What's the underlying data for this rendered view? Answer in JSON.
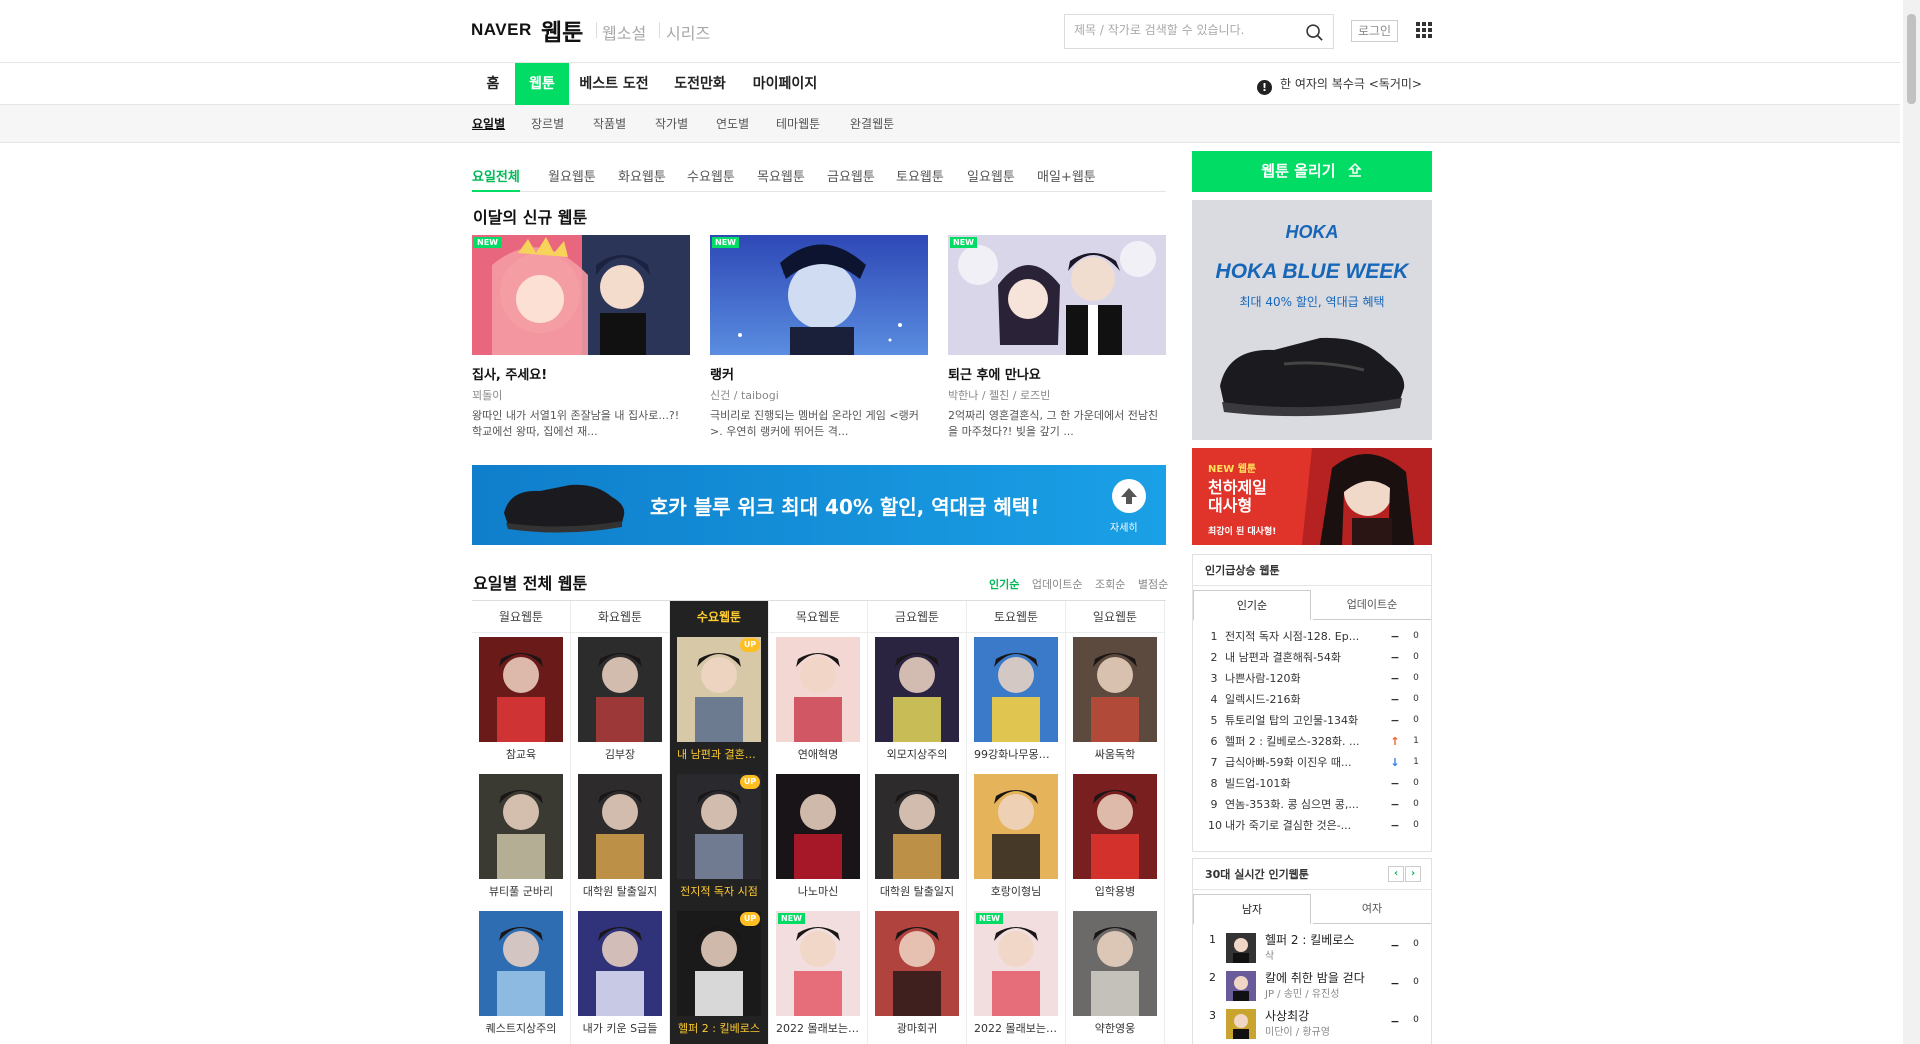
{
  "header": {
    "logo_naver": "NAVER",
    "logo_webtoon": "웹툰",
    "link_webnovel": "웹소설",
    "link_series": "시리즈",
    "search_placeholder": "제목 / 작가로 검색할 수 있습니다.",
    "login_label": "로그인"
  },
  "gnb": {
    "items": [
      "홈",
      "웹툰",
      "베스트 도전",
      "도전만화",
      "마이페이지"
    ],
    "active": "웹툰",
    "notice": "한 여자의 복수극 <독거미>"
  },
  "snb": {
    "items": [
      "요일별",
      "장르별",
      "작품별",
      "작가별",
      "연도별",
      "테마웹툰",
      "완결웹툰"
    ],
    "active": "요일별"
  },
  "day_tabs": {
    "items": [
      "요일전체",
      "월요웹툰",
      "화요웹툰",
      "수요웹툰",
      "목요웹툰",
      "금요웹툰",
      "토요웹툰",
      "일요웹툰",
      "매일+웹툰"
    ],
    "active": "요일전체"
  },
  "new_section": {
    "title": "이달의 신규 웹툰",
    "badge": "NEW",
    "cards": [
      {
        "title": "집사, 주세요!",
        "author": "꾀돌이",
        "desc": "왕따인 내가 서열1위 존잘남을 내 집사로...?! 학교에선 왕따, 집에선 재..."
      },
      {
        "title": "랭커",
        "author": "신건 / taibogi",
        "desc": "극비리로 진행되는 멤버쉽 온라인 게임 <랭커>. 우연히 랭커에 뛰어든 격..."
      },
      {
        "title": "퇴근 후에 만나요",
        "author": "박한나 / 젤친 / 로즈빈",
        "desc": "2억짜리 영혼결혼식, 그 한 가운데에서 전남친을 마주쳤다?! 빚을 갚기 ..."
      }
    ]
  },
  "banner": {
    "text": "호카 블루 위크 최대 40% 할인, 역대급 혜택!",
    "more_label": "자세히"
  },
  "weekday_section": {
    "title": "요일별 전체 웹툰",
    "sort_options": [
      "인기순",
      "업데이트순",
      "조회순",
      "별점순"
    ],
    "active_sort": "인기순",
    "active_day": "수요웹툰",
    "badge_up": "UP",
    "columns": [
      {
        "day": "월요웹툰",
        "items": [
          {
            "title": "참교육"
          },
          {
            "title": "뷰티풀 군바리"
          },
          {
            "title": "퀘스트지상주의"
          }
        ]
      },
      {
        "day": "화요웹툰",
        "items": [
          {
            "title": "김부장"
          },
          {
            "title": "대학원 탈출일지"
          },
          {
            "title": "내가 키운 S급들"
          }
        ]
      },
      {
        "day": "수요웹툰",
        "items": [
          {
            "title": "내 남편과 결혼해줘",
            "up": true
          },
          {
            "title": "전지적 독자 시점",
            "up": true
          },
          {
            "title": "헬퍼 2 : 킬베로스",
            "up": true
          }
        ]
      },
      {
        "day": "목요웹툰",
        "items": [
          {
            "title": "연애혁명"
          },
          {
            "title": "나노마신"
          },
          {
            "title": "2022 몰래보는 로맨스",
            "new": true
          }
        ]
      },
      {
        "day": "금요웹툰",
        "items": [
          {
            "title": "외모지상주의"
          },
          {
            "title": "대학원 탈출일지"
          },
          {
            "title": "광마회귀"
          }
        ]
      },
      {
        "day": "토요웹툰",
        "items": [
          {
            "title": "99강화나무몽둥이"
          },
          {
            "title": "호랑이형님"
          },
          {
            "title": "2022 몰래보는 로맨스",
            "new": true
          }
        ]
      },
      {
        "day": "일요웹툰",
        "items": [
          {
            "title": "싸움독학"
          },
          {
            "title": "입학용병"
          },
          {
            "title": "약한영웅"
          }
        ]
      }
    ]
  },
  "sidebar": {
    "upload_label": "웹툰 올리기",
    "ad": {
      "brand": "HOKA",
      "title": "HOKA BLUE WEEK",
      "sub": "최대 40% 할인, 역대급 혜택"
    },
    "promo": {
      "label": "NEW 웹툰",
      "title": "천하제일 대사형",
      "sub": "최강이 된 대사형!"
    },
    "ranking": {
      "title": "인기급상승 웹툰",
      "tabs": [
        "인기순",
        "업데이트순"
      ],
      "active_tab": "인기순",
      "items": [
        {
          "rank": "1",
          "title": "전지적 독자 시점-128. Ep...",
          "trend": "same",
          "delta": "0"
        },
        {
          "rank": "2",
          "title": "내 남편과 결혼해줘-54화",
          "trend": "same",
          "delta": "0"
        },
        {
          "rank": "3",
          "title": "나쁜사람-120화",
          "trend": "same",
          "delta": "0"
        },
        {
          "rank": "4",
          "title": "일렉시드-216화",
          "trend": "same",
          "delta": "0"
        },
        {
          "rank": "5",
          "title": "튜토리얼 탑의 고인물-134화",
          "trend": "same",
          "delta": "0"
        },
        {
          "rank": "6",
          "title": "헬퍼 2 : 킬베로스-328화. ...",
          "trend": "up",
          "delta": "1"
        },
        {
          "rank": "7",
          "title": "급식아빠-59화 이진우 때...",
          "trend": "down",
          "delta": "1"
        },
        {
          "rank": "8",
          "title": "빌드업-101화",
          "trend": "same",
          "delta": "0"
        },
        {
          "rank": "9",
          "title": "연놈-353화. 콩 심으면 콩,...",
          "trend": "same",
          "delta": "0"
        },
        {
          "rank": "10",
          "title": "내가 죽기로 결심한 것은-...",
          "trend": "same",
          "delta": "0"
        }
      ]
    },
    "realtime": {
      "title": "30대 실시간 인기웹툰",
      "tabs": [
        "남자",
        "여자"
      ],
      "active_tab": "남자",
      "items": [
        {
          "rank": "1",
          "title": "헬퍼 2 : 킬베로스",
          "author": "삭",
          "delta": "0"
        },
        {
          "rank": "2",
          "title": "칼에 취한 밤을 걷다",
          "author": "JP / 송민 / 유진성",
          "delta": "0"
        },
        {
          "rank": "3",
          "title": "사상최강",
          "author": "미단이 / 황규영",
          "delta": "0"
        }
      ]
    }
  },
  "colors": {
    "brand": "#00dc64",
    "active_col_bg": "#222222",
    "active_col_text": "#ffcc2f",
    "trend_up": "#f05c22",
    "trend_down": "#2b79e8"
  }
}
